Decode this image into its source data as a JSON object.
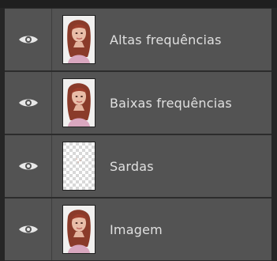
{
  "layers_panel": {
    "layers": [
      {
        "name": "Altas frequências",
        "thumbnail": "portrait",
        "visible": true
      },
      {
        "name": "Baixas frequências",
        "thumbnail": "portrait",
        "visible": true
      },
      {
        "name": "Sardas",
        "thumbnail": "transparent-checkerboard",
        "visible": true
      },
      {
        "name": "Imagem",
        "thumbnail": "portrait",
        "visible": true
      }
    ]
  },
  "icons": {
    "visibility": "eye-icon"
  },
  "colors": {
    "panel_bg": "#535353",
    "text": "#e0e0e0",
    "frame": "#262626"
  }
}
